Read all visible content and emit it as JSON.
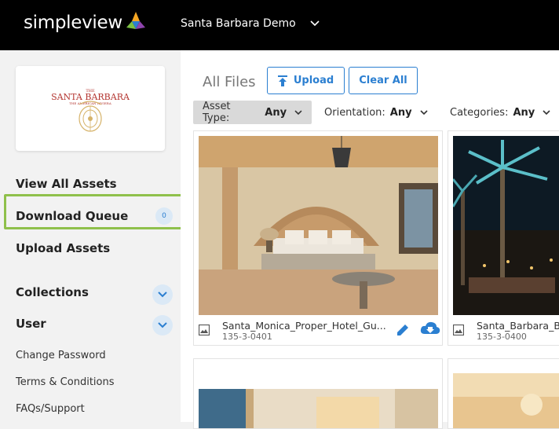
{
  "header": {
    "logo_text": "simpleview",
    "site_name": "Santa Barbara Demo"
  },
  "sidebar": {
    "brand": {
      "line1": "THE",
      "name": "SANTA BARBARA",
      "tagline": "THE AMERICAN RIVIERA"
    },
    "nav": [
      {
        "label": "View All Assets"
      },
      {
        "label": "Download Queue",
        "badge": "0"
      },
      {
        "label": "Upload Assets"
      }
    ],
    "sections": [
      {
        "label": "Collections"
      },
      {
        "label": "User"
      }
    ],
    "links": [
      {
        "label": "Change Password"
      },
      {
        "label": "Terms & Conditions"
      },
      {
        "label": "FAQs/Support"
      }
    ]
  },
  "main": {
    "title": "All Files",
    "upload_label": "Upload",
    "clear_label": "Clear All",
    "filters": [
      {
        "label": "Asset Type:",
        "value": "Any"
      },
      {
        "label": "Orientation:",
        "value": "Any"
      },
      {
        "label": "Categories:",
        "value": "Any"
      }
    ],
    "assets": [
      {
        "name": "Santa_Monica_Proper_Hotel_Gu...",
        "id": "135-3-0401"
      },
      {
        "name": "Santa_Barbara_Be",
        "id": "135-3-0400"
      }
    ]
  },
  "colors": {
    "accent": "#2b7fd1",
    "highlight": "#8fc04b",
    "brand_red": "#b3342f"
  }
}
